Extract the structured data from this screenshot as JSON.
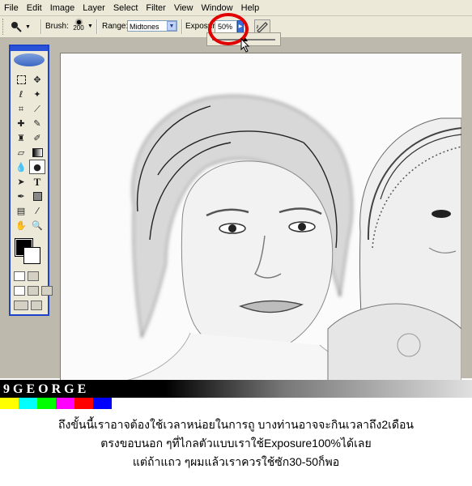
{
  "menu": [
    "File",
    "Edit",
    "Image",
    "Layer",
    "Select",
    "Filter",
    "View",
    "Window",
    "Help"
  ],
  "options_bar": {
    "brush_label": "Brush:",
    "brush_size": "200",
    "range_label": "Range:",
    "range_value": "Midtones",
    "exposure_label": "Exposure:",
    "exposure_value": "50%"
  },
  "annotation": {
    "color": "#e00000"
  },
  "toolbox": {
    "accent": "#1c43c9",
    "tools": [
      "marquee-icon",
      "move-icon",
      "lasso-icon",
      "magic-wand-icon",
      "crop-icon",
      "slice-icon",
      "healing-brush-icon",
      "brush-icon",
      "clone-stamp-icon",
      "history-brush-icon",
      "eraser-icon",
      "gradient-icon",
      "blur-icon",
      "dodge-icon",
      "path-select-icon",
      "type-icon",
      "pen-icon",
      "shape-icon",
      "notes-icon",
      "eyedropper-icon",
      "hand-icon",
      "zoom-icon"
    ],
    "active_tool": "dodge-icon"
  },
  "logo": {
    "text": "9GEORGE"
  },
  "color_strip": [
    "#ffff00",
    "#00ffff",
    "#00ff00",
    "#ff00ff",
    "#ff0000",
    "#0000ff"
  ],
  "caption": {
    "line1": "ถึงขั้นนี้เราอาจต้องใช้เวลาหน่อยในการถู บางท่านอาจจะกินเวลาถึง2เดือน",
    "line2": "ตรงขอบนอก ๆที่ไกลตัวแบบเราใช้Exposure100%ได้เลย",
    "line3": "แต่ถ้าแถว ๆผมแล้วเราควรใช้ซัก30-50ก็พอ"
  }
}
